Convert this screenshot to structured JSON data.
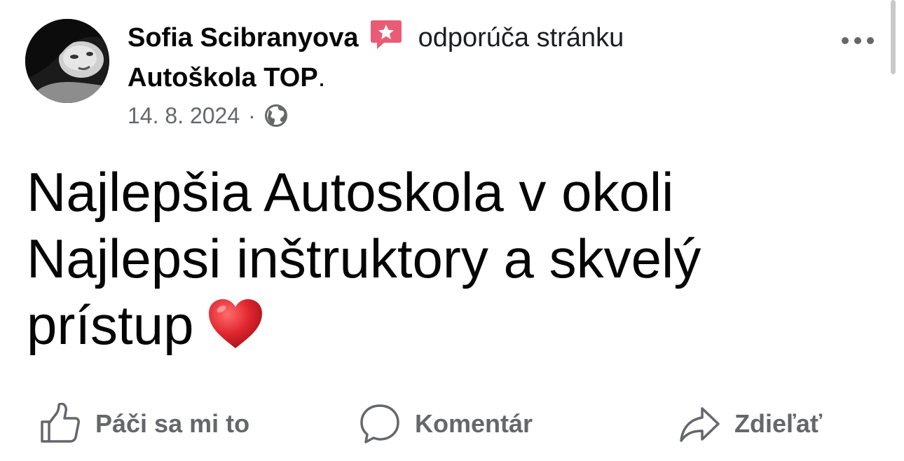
{
  "post": {
    "author": "Sofia Scibranyova",
    "action_text": "odporúča stránku",
    "page_name": "Autoškola TOP",
    "page_name_suffix": ".",
    "date": "14. 8. 2024",
    "separator": "·",
    "privacy_icon": "globe-icon",
    "badge_icon": "recommendation-star-icon",
    "more_icon": "more-dots-icon",
    "body_lines": [
      "Najlepšia Autoskola v okoli",
      "Najlepsi inštruktory a skvelý",
      "prístup"
    ],
    "emoji": "heart"
  },
  "actions": {
    "like_label": "Páči sa mi to",
    "comment_label": "Komentár",
    "share_label": "Zdieľať"
  },
  "colors": {
    "badge": "#e85d75",
    "secondary_text": "#65676b",
    "heart": "#e0262f"
  }
}
